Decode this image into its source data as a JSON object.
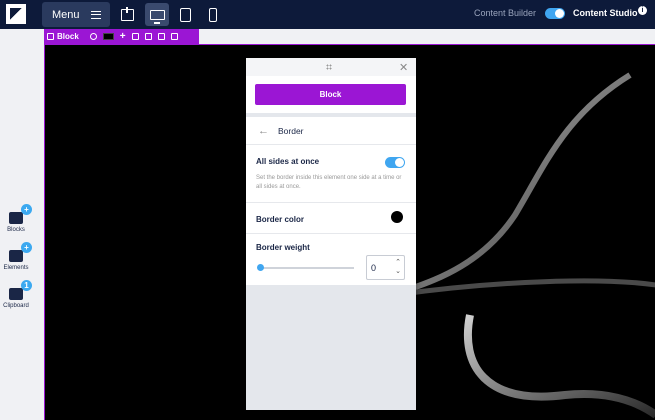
{
  "topbar": {
    "menu_label": "Menu",
    "content_builder_label": "Content Builder",
    "content_studio_label": "Content Studio",
    "info_symbol": "i",
    "toggle_on": true,
    "active_view": "desktop"
  },
  "blockbar": {
    "label": "Block",
    "icons": [
      "drag-handle-icon",
      "gear-icon",
      "color-swatch",
      "plus-icon",
      "download-icon",
      "copy-icon",
      "paste-icon",
      "trash-icon"
    ]
  },
  "sidebar": {
    "items": [
      {
        "label": "Blocks",
        "badge": "+",
        "icon": "blocks-icon"
      },
      {
        "label": "Elements",
        "badge": "+",
        "icon": "elements-icon"
      },
      {
        "label": "Clipboard",
        "badge": "1",
        "icon": "clipboard-icon"
      }
    ]
  },
  "panel": {
    "block_button": "Block",
    "section_title": "Border",
    "all_sides_label": "All sides at once",
    "all_sides_on": true,
    "help_text": "Set the border inside this element one side at a time or all sides at once.",
    "border_color_label": "Border color",
    "border_color_value": "#000000",
    "border_weight_label": "Border weight",
    "border_weight_value": "0",
    "border_weight_slider_fraction": 0
  },
  "colors": {
    "topbar_bg": "#0d1a3a",
    "accent_purple": "#9b16d4",
    "toggle_blue": "#40a6f0"
  }
}
